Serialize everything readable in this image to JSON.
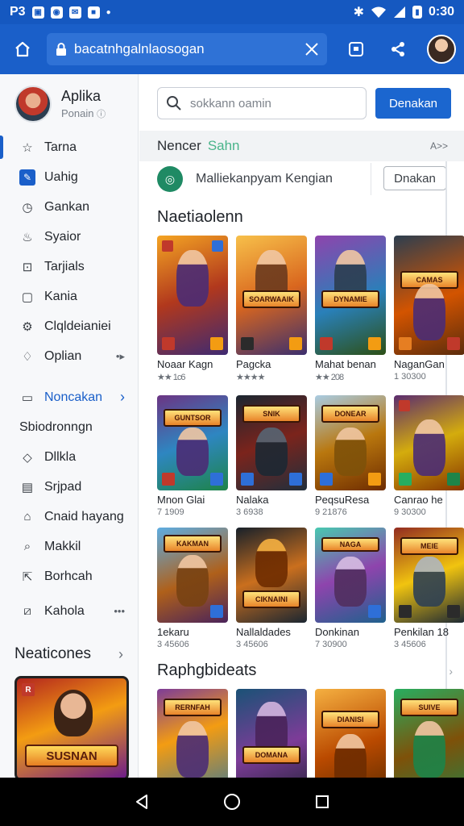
{
  "status_bar": {
    "left_text": "P3",
    "time": "0:30",
    "icons": [
      "gallery-icon",
      "messenger-icon",
      "mail-icon",
      "notification-icon",
      "bluetooth-icon",
      "wifi-icon",
      "signal-icon",
      "battery-icon"
    ]
  },
  "app_bar": {
    "url": "bacatnhgalnlaosogan",
    "icons": [
      "home-icon",
      "lock-icon",
      "close-icon",
      "tab-icon",
      "share-icon",
      "avatar"
    ]
  },
  "sidebar": {
    "profile": {
      "name": "Aplika",
      "subtitle": "Ponain"
    },
    "items": [
      {
        "label": "Tarna",
        "icon": "star-outline-icon",
        "active": true
      },
      {
        "label": "Uahig",
        "icon": "edit-icon"
      },
      {
        "label": "Gankan",
        "icon": "clock-icon"
      },
      {
        "label": "Syaior",
        "icon": "flame-icon"
      },
      {
        "label": "Tarjials",
        "icon": "bag-icon"
      },
      {
        "label": "Kania",
        "icon": "square-icon"
      },
      {
        "label": "Clqldeianiei",
        "icon": "settings-icon"
      },
      {
        "label": "Oplian",
        "icon": "tag-icon",
        "trail": "•▸"
      }
    ],
    "items2": [
      {
        "label": "Noncakan",
        "icon": "folder-icon",
        "trail": "›",
        "highlight": true
      },
      {
        "label": "Sbiodronngn",
        "icon": ""
      },
      {
        "label": "Dllkla",
        "icon": "tag-icon"
      },
      {
        "label": "Srjpad",
        "icon": "calendar-icon"
      },
      {
        "label": "Cnaid hayang",
        "icon": "home-outline-icon"
      },
      {
        "label": "Makkil",
        "icon": "search-icon"
      },
      {
        "label": "Borhcah",
        "icon": "share-icon"
      },
      {
        "label": "Kahola",
        "icon": "edit-icon",
        "trail": "•••"
      }
    ],
    "section_title": "Neaticones",
    "section_thumb_title": "SUSNAN"
  },
  "main": {
    "search": {
      "placeholder": "sokkann oamin",
      "button": "Denakan"
    },
    "subhead": {
      "title": "Nencer",
      "accent": "Sahn",
      "more": "A>>"
    },
    "featured_app": {
      "name": "Malliekanpyam Kengian",
      "button": "Dnakan"
    },
    "section1_title": "Naetiaolenn",
    "section2_title": "Raphgbideats",
    "colors": {
      "accent": "#1a5fc9",
      "button": "#1b66cf",
      "star": "#f0a500"
    },
    "games_row1": [
      {
        "name": "Noaar Kagn",
        "meta": "★★ 1c6",
        "plate": ""
      },
      {
        "name": "Pagcka",
        "meta": "★★★★",
        "plate": "SOARWAAIK"
      },
      {
        "name": "Mahat benan",
        "meta": "★★ 208",
        "plate": "DYNAMIE"
      },
      {
        "name": "NaganGan",
        "meta": "1 30300",
        "plate": "CAMAS"
      }
    ],
    "games_row2": [
      {
        "name": "Mnon Glai",
        "meta": "7 1909",
        "plate": "GUNTSOR"
      },
      {
        "name": "Nalaka",
        "meta": "3 6938",
        "plate": "SNIK"
      },
      {
        "name": "PeqsuResa",
        "meta": "9 21876",
        "plate": "DONEAR"
      },
      {
        "name": "Canrao he",
        "meta": "9 30300",
        "plate": ""
      }
    ],
    "games_row3": [
      {
        "name": "1ekaru",
        "meta": "3 45606",
        "plate": "KAKMAN"
      },
      {
        "name": "Nallaldades",
        "meta": "3 45606",
        "plate": "CIKNAINI"
      },
      {
        "name": "Donkinan",
        "meta": "7 30900",
        "plate": "NAGA"
      },
      {
        "name": "Penkilan 18",
        "meta": "3 45606",
        "plate": "MEIE"
      }
    ],
    "games_row4": [
      {
        "name": "",
        "meta": "",
        "plate": "RERNFAH"
      },
      {
        "name": "",
        "meta": "",
        "plate": "DOMANA"
      },
      {
        "name": "",
        "meta": "",
        "plate": "DIANISI"
      },
      {
        "name": "",
        "meta": "",
        "plate": "SUIVE"
      }
    ]
  },
  "nav_bar": {
    "icons": [
      "back-icon",
      "home-circle-icon",
      "recents-icon"
    ]
  }
}
